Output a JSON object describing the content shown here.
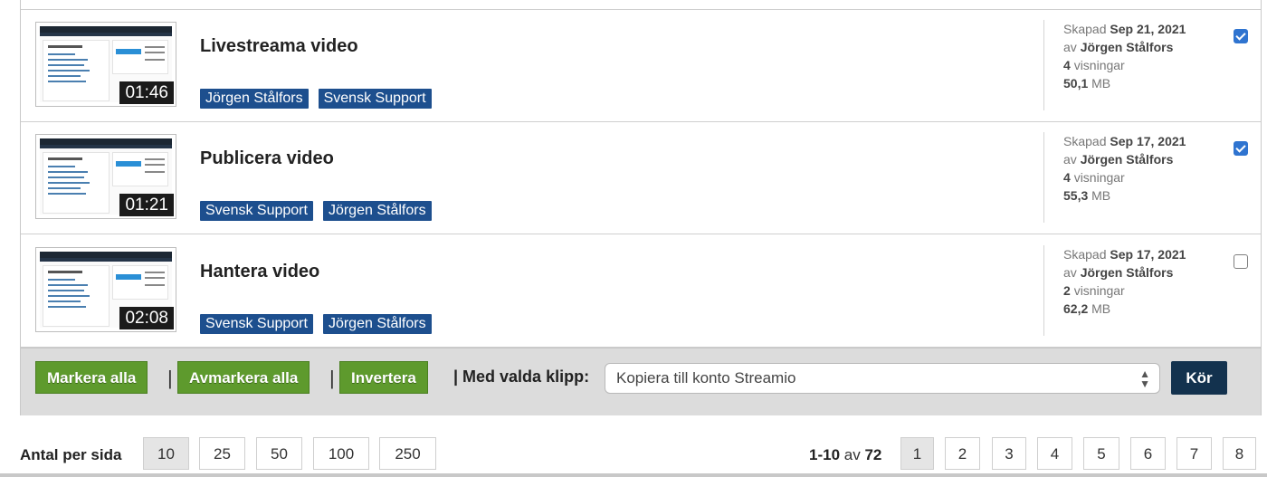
{
  "videos": [
    {
      "title": "Livestreama video",
      "duration": "01:46",
      "tags": [
        "Jörgen Stålfors",
        "Svensk Support"
      ],
      "created_label": "Skapad",
      "created_date": "Sep 21, 2021",
      "by_label": "av",
      "author": "Jörgen Stålfors",
      "views_count": "4",
      "views_label": "visningar",
      "size_value": "50,1",
      "size_unit": "MB",
      "checked": true
    },
    {
      "title": "Publicera video",
      "duration": "01:21",
      "tags": [
        "Svensk Support",
        "Jörgen Stålfors"
      ],
      "created_label": "Skapad",
      "created_date": "Sep 17, 2021",
      "by_label": "av",
      "author": "Jörgen Stålfors",
      "views_count": "4",
      "views_label": "visningar",
      "size_value": "55,3",
      "size_unit": "MB",
      "checked": true
    },
    {
      "title": "Hantera video",
      "duration": "02:08",
      "tags": [
        "Svensk Support",
        "Jörgen Stålfors"
      ],
      "created_label": "Skapad",
      "created_date": "Sep 17, 2021",
      "by_label": "av",
      "author": "Jörgen Stålfors",
      "views_count": "2",
      "views_label": "visningar",
      "size_value": "62,2",
      "size_unit": "MB",
      "checked": false
    }
  ],
  "actions": {
    "select_all": "Markera alla",
    "deselect_all": "Avmarkera alla",
    "invert": "Invertera",
    "separator": "|",
    "with_selected": "| Med valda klipp:",
    "selected_action": "Kopiera till konto Streamio",
    "run": "Kör"
  },
  "footer": {
    "per_page_label": "Antal per sida",
    "per_page_options": [
      "10",
      "25",
      "50",
      "100",
      "250"
    ],
    "per_page_selected": "10",
    "range_text": "1-10",
    "range_of": "av",
    "total": "72",
    "pages": [
      "1",
      "2",
      "3",
      "4",
      "5",
      "6",
      "7",
      "8"
    ],
    "current_page": "1"
  },
  "colors": {
    "tag_bg": "#1d4f8e",
    "green_button": "#5e9a2d",
    "run_button": "#13324e",
    "checkbox_checked": "#2f74d0",
    "action_bar_bg": "#dcdcdc"
  }
}
